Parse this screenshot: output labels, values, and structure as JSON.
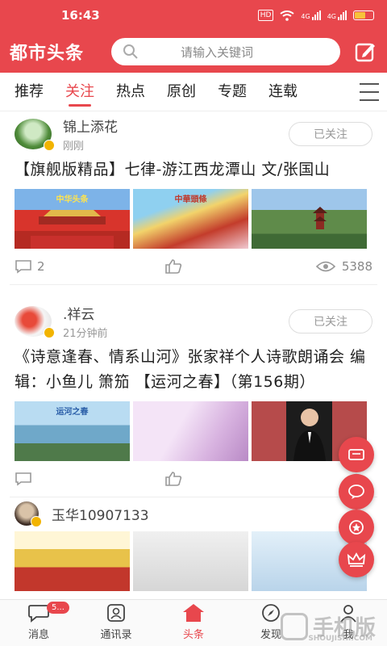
{
  "status_bar": {
    "time": "16:43",
    "hd": "HD",
    "net1": "4G",
    "net2": "4G"
  },
  "header": {
    "app_title": "都市头条",
    "search_placeholder": "请输入关键词"
  },
  "tabs": [
    "推荐",
    "关注",
    "热点",
    "原创",
    "专题",
    "连载"
  ],
  "active_tab": "关注",
  "posts": [
    {
      "author": "锦上添花",
      "time": "刚刚",
      "follow_label": "已关注",
      "title": "【旗舰版精品】七律-游江西龙潭山 文/张国山",
      "thumb_captions": [
        "中华头条",
        "中華頭條",
        ""
      ],
      "comments": "2",
      "views": "5388"
    },
    {
      "author": ".祥云",
      "time": "21分钟前",
      "follow_label": "已关注",
      "title": "《诗意逢春、情系山河》张家祥个人诗歌朗诵会 编辑：小鱼儿 箫笳 【运河之春】（第156期）",
      "thumb_captions": [
        "运河之春",
        "",
        ""
      ],
      "comments": "",
      "views": ""
    },
    {
      "author": "玉华10907133",
      "time": "",
      "follow_label": "",
      "title": "",
      "thumb_captions": [
        "",
        "",
        ""
      ],
      "comments": "",
      "views": ""
    }
  ],
  "bottom_nav": {
    "items": [
      "消息",
      "通讯录",
      "头条",
      "发现",
      "我"
    ],
    "active": "头条",
    "message_badge": "5..."
  },
  "watermark": {
    "text": "手机版",
    "sub": "SHOUJISHI.COM"
  },
  "colors": {
    "brand": "#e8474d",
    "badge": "#f2b400"
  }
}
